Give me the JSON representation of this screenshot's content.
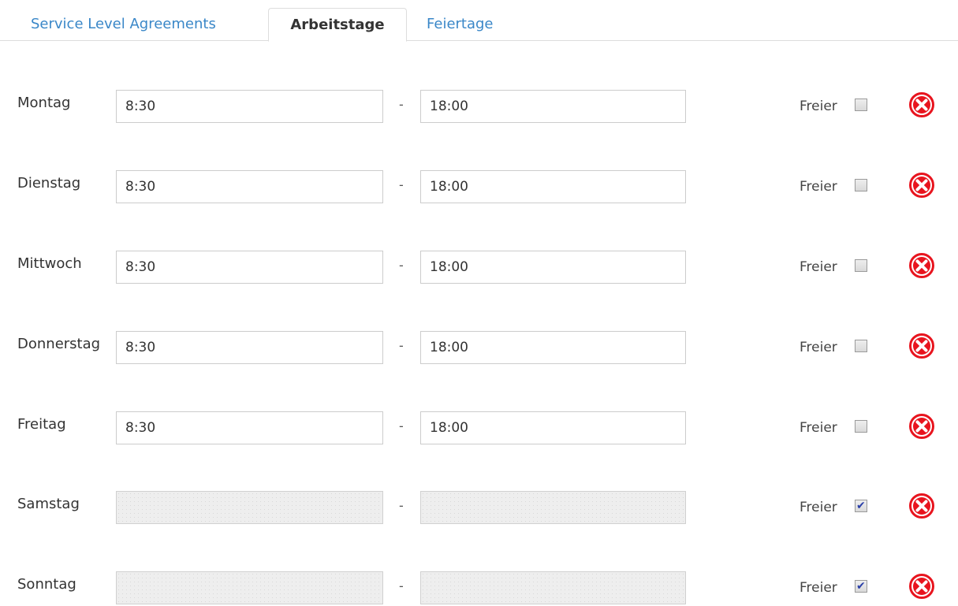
{
  "tabs": [
    {
      "label": "Service Level Agreements",
      "active": false
    },
    {
      "label": "Arbeitstage",
      "active": true
    },
    {
      "label": "Feiertage",
      "active": false
    }
  ],
  "separator": "-",
  "free_label": "Freier",
  "colors": {
    "link": "#3a87c8",
    "delete_icon": "#e8141e",
    "checkbox_check": "#2a3fa8"
  },
  "days": [
    {
      "name": "Montag",
      "start": "8:30",
      "end": "18:00",
      "free": false
    },
    {
      "name": "Dienstag",
      "start": "8:30",
      "end": "18:00",
      "free": false
    },
    {
      "name": "Mittwoch",
      "start": "8:30",
      "end": "18:00",
      "free": false
    },
    {
      "name": "Donnerstag",
      "start": "8:30",
      "end": "18:00",
      "free": false
    },
    {
      "name": "Freitag",
      "start": "8:30",
      "end": "18:00",
      "free": false
    },
    {
      "name": "Samstag",
      "start": "",
      "end": "",
      "free": true
    },
    {
      "name": "Sonntag",
      "start": "",
      "end": "",
      "free": true
    }
  ]
}
